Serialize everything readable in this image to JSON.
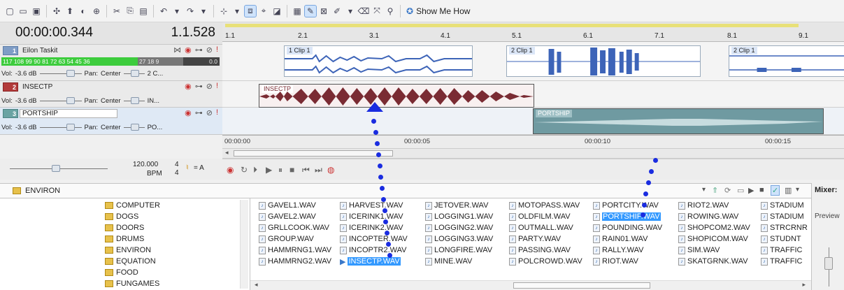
{
  "toolbar": {
    "show_me_how": "Show Me How"
  },
  "time_display": {
    "timecode": "00:00:00.344",
    "measure": "1.1.528"
  },
  "ruler": {
    "beats": [
      "1.1",
      "2.1",
      "3.1",
      "4.1",
      "5.1",
      "6.1",
      "7.1",
      "8.1",
      "9.1"
    ]
  },
  "tracks": [
    {
      "number": "1",
      "name": "Eilon Taskit",
      "vol_label": "Vol:",
      "vol_value": "-3.6 dB",
      "pan_label": "Pan:",
      "pan_value": "Center",
      "clip_short": "2 C...",
      "meter_green": "117 108 99 90 81 72 63 54 45 36",
      "meter_dark": "27 18 9",
      "meter_value": "0.0"
    },
    {
      "number": "2",
      "name": "INSECTP",
      "vol_label": "Vol:",
      "vol_value": "-3.6 dB",
      "pan_label": "Pan:",
      "pan_value": "Center",
      "clip_short": "IN..."
    },
    {
      "number": "3",
      "name": "PORTSHIP",
      "vol_label": "Vol:",
      "vol_value": "-3.6 dB",
      "pan_label": "Pan:",
      "pan_value": "Center",
      "clip_short": "PO..."
    }
  ],
  "clips": {
    "clip1": "1 Clip 1",
    "clip2a": "2 Clip 1",
    "clip2b": "2 Clip 1",
    "insect": "INSECTP",
    "portship": "PORTSHIP"
  },
  "time_ruler": [
    "00:00:00",
    "00:00:05",
    "00:00:10",
    "00:00:15"
  ],
  "tempo": {
    "bpm_value": "120.000",
    "bpm_label": "BPM",
    "ts_top": "4",
    "ts_bottom": "4",
    "key": "= A"
  },
  "explorer": {
    "path": "ENVIRON",
    "mixer_label": "Mixer:",
    "preview_label": "Preview"
  },
  "folders": [
    "COMPUTER",
    "DOGS",
    "DOORS",
    "DRUMS",
    "ENVIRON",
    "EQUATION",
    "FOOD",
    "FUNGAMES"
  ],
  "files": [
    [
      "GAVEL1.WAV",
      "GAVEL2.WAV",
      "GRLLCOOK.WAV",
      "GROUP.WAV",
      "HAMMRNG1.WAV",
      "HAMMRNG2.WAV"
    ],
    [
      "HARVEST.WAV",
      "ICERINK1.WAV",
      "ICERINK2.WAV",
      "INCOPTER.WAV",
      "INCOPTR2.WAV",
      "INSECTP.WAV"
    ],
    [
      "JETOVER.WAV",
      "LOGGING1.WAV",
      "LOGGING2.WAV",
      "LOGGING3.WAV",
      "LONGFIRE.WAV",
      "MINE.WAV"
    ],
    [
      "MOTOPASS.WAV",
      "OLDFILM.WAV",
      "OUTMALL.WAV",
      "PARTY.WAV",
      "PASSING.WAV",
      "POLCROWD.WAV"
    ],
    [
      "PORTCITY.WAV",
      "PORTSHIP.WAV",
      "POUNDING.WAV",
      "RAIN01.WAV",
      "RALLY.WAV",
      "RIOT.WAV"
    ],
    [
      "RIOT2.WAV",
      "ROWING.WAV",
      "SHOPCOM2.WAV",
      "SHOPICOM.WAV",
      "SIM.WAV",
      "SKATGRNK.WAV"
    ],
    [
      "STADIUM",
      "STADIUM",
      "STRCRNR",
      "STUDNT",
      "TRAFFIC",
      "TRAFFIC"
    ]
  ],
  "colors": {
    "insect_clip": "#7a2b33",
    "portship_clip": "#6f9aa1",
    "vocal_wave": "#3d64b8",
    "selection": "#3399ff",
    "annotation": "#1a2ce0"
  }
}
